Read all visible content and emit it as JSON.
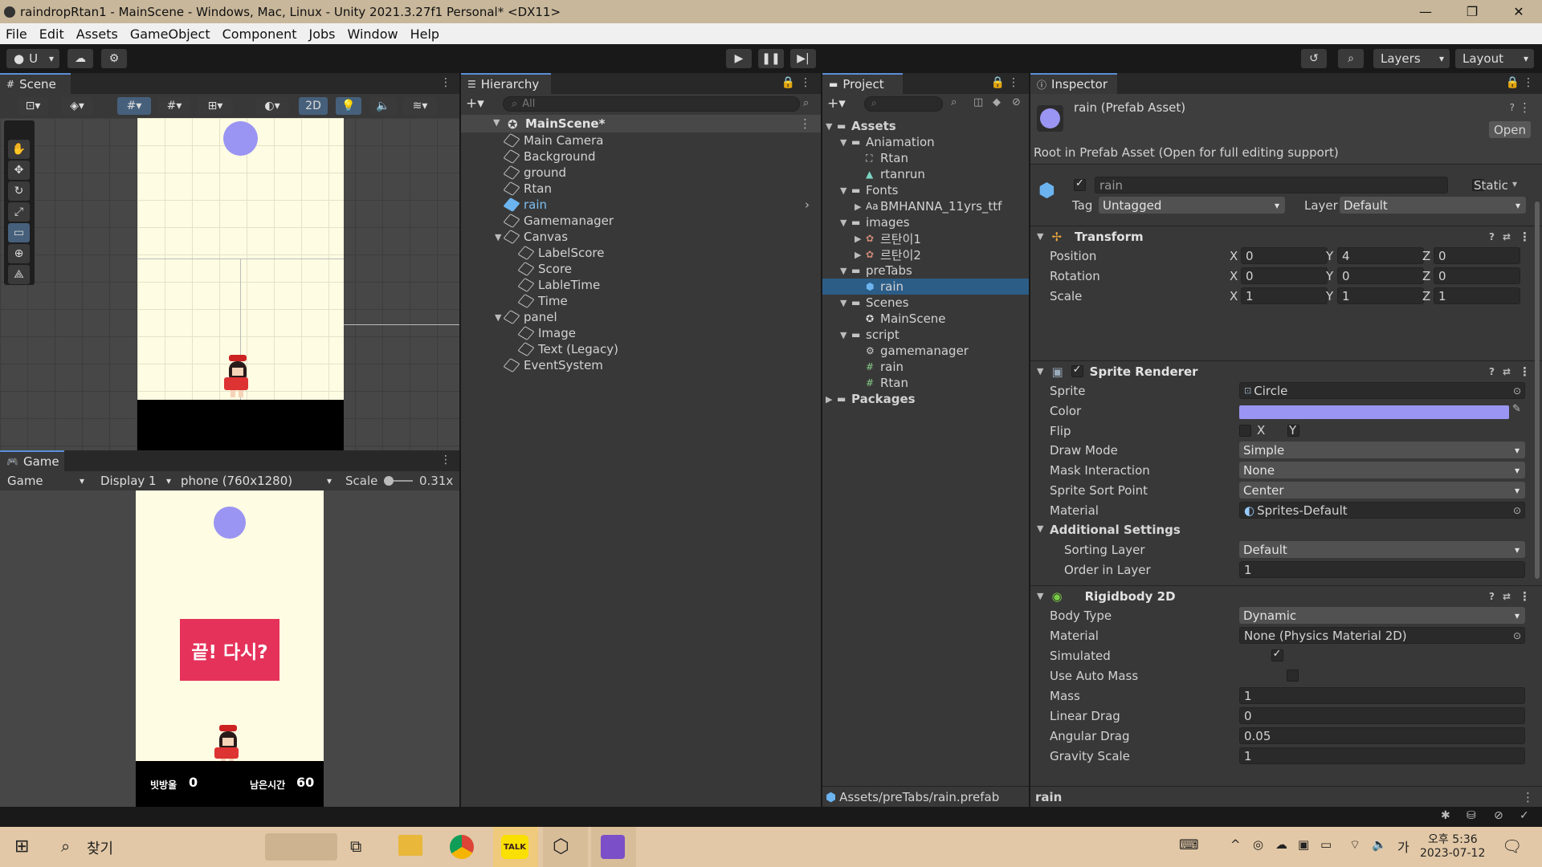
{
  "window": {
    "title": "raindropRtan1 - MainScene - Windows, Mac, Linux - Unity 2021.3.27f1 Personal* <DX11>",
    "minimize": "—",
    "restore": "❐",
    "close": "✕"
  },
  "menu": [
    "File",
    "Edit",
    "Assets",
    "GameObject",
    "Component",
    "Jobs",
    "Window",
    "Help"
  ],
  "toolbar": {
    "account": "U",
    "layers": "Layers",
    "layout": "Layout"
  },
  "scene": {
    "tab": "Scene",
    "mode_2d": "2D"
  },
  "game": {
    "tab": "Game",
    "mode": "Game",
    "display": "Display 1",
    "resolution": "phone (760x1280)",
    "scale_label": "Scale",
    "scale_value": "0.31x",
    "end_button": "끝! 다시?",
    "hud_score_label": "빗방울",
    "hud_score_value": "0",
    "hud_time_label": "남은시간",
    "hud_time_value": "60"
  },
  "hierarchy": {
    "tab": "Hierarchy",
    "search_placeholder": "All",
    "root": "MainScene*",
    "items": [
      {
        "label": "Main Camera",
        "depth": 1
      },
      {
        "label": "Background",
        "depth": 1
      },
      {
        "label": "ground",
        "depth": 1
      },
      {
        "label": "Rtan",
        "depth": 1
      },
      {
        "label": "rain",
        "depth": 1,
        "prefab": true
      },
      {
        "label": "Gamemanager",
        "depth": 1
      },
      {
        "label": "Canvas",
        "depth": 1,
        "expanded": true
      },
      {
        "label": "LabelScore",
        "depth": 2
      },
      {
        "label": "Score",
        "depth": 2
      },
      {
        "label": "LableTime",
        "depth": 2
      },
      {
        "label": "Time",
        "depth": 2
      },
      {
        "label": "panel",
        "depth": 1,
        "expanded": true
      },
      {
        "label": "Image",
        "depth": 2
      },
      {
        "label": "Text (Legacy)",
        "depth": 2
      },
      {
        "label": "EventSystem",
        "depth": 1
      }
    ]
  },
  "project": {
    "tab": "Project",
    "items": [
      {
        "label": "Assets",
        "depth": 0,
        "type": "folder",
        "expanded": true,
        "bold": true
      },
      {
        "label": "Aniamation",
        "depth": 1,
        "type": "folder",
        "expanded": true
      },
      {
        "label": "Rtan",
        "depth": 2,
        "type": "anim"
      },
      {
        "label": "rtanrun",
        "depth": 2,
        "type": "clip"
      },
      {
        "label": "Fonts",
        "depth": 1,
        "type": "folder",
        "expanded": true
      },
      {
        "label": "BMHANNA_11yrs_ttf",
        "depth": 2,
        "type": "font",
        "collapsed": true
      },
      {
        "label": "images",
        "depth": 1,
        "type": "folder",
        "expanded": true
      },
      {
        "label": "르탄이1",
        "depth": 2,
        "type": "sprite",
        "collapsed": true
      },
      {
        "label": "르탄이2",
        "depth": 2,
        "type": "sprite",
        "collapsed": true
      },
      {
        "label": "preTabs",
        "depth": 1,
        "type": "folder",
        "expanded": true
      },
      {
        "label": "rain",
        "depth": 2,
        "type": "prefab",
        "selected": true
      },
      {
        "label": "Scenes",
        "depth": 1,
        "type": "folder",
        "expanded": true
      },
      {
        "label": "MainScene",
        "depth": 2,
        "type": "scene"
      },
      {
        "label": "script",
        "depth": 1,
        "type": "folder",
        "expanded": true
      },
      {
        "label": "gamemanager",
        "depth": 2,
        "type": "gear"
      },
      {
        "label": "rain",
        "depth": 2,
        "type": "script"
      },
      {
        "label": "Rtan",
        "depth": 2,
        "type": "script"
      },
      {
        "label": "Packages",
        "depth": 0,
        "type": "folder",
        "collapsed": true,
        "bold": true
      }
    ],
    "path": "Assets/preTabs/rain.prefab"
  },
  "inspector": {
    "tab": "Inspector",
    "asset_title": "rain (Prefab Asset)",
    "open_button": "Open",
    "root_note": "Root in Prefab Asset (Open for full editing support)",
    "name": "rain",
    "static_label": "Static",
    "tag_label": "Tag",
    "tag_value": "Untagged",
    "layer_label": "Layer",
    "layer_value": "Default",
    "transform": {
      "title": "Transform",
      "position_label": "Position",
      "position": {
        "x": "0",
        "y": "4",
        "z": "0"
      },
      "rotation_label": "Rotation",
      "rotation": {
        "x": "0",
        "y": "0",
        "z": "0"
      },
      "scale_label": "Scale",
      "scale": {
        "x": "1",
        "y": "1",
        "z": "1"
      }
    },
    "sprite_renderer": {
      "title": "Sprite Renderer",
      "sprite_label": "Sprite",
      "sprite_value": "Circle",
      "color_label": "Color",
      "color_value": "#9a95f2",
      "flip_label": "Flip",
      "flip_x": "X",
      "flip_y": "Y",
      "draw_mode_label": "Draw Mode",
      "draw_mode": "Simple",
      "mask_label": "Mask Interaction",
      "mask": "None",
      "sort_point_label": "Sprite Sort Point",
      "sort_point": "Center",
      "material_label": "Material",
      "material": "Sprites-Default",
      "additional_label": "Additional Settings",
      "sorting_layer_label": "Sorting Layer",
      "sorting_layer": "Default",
      "order_label": "Order in Layer",
      "order": "1"
    },
    "rigidbody": {
      "title": "Rigidbody 2D",
      "body_type_label": "Body Type",
      "body_type": "Dynamic",
      "material_label": "Material",
      "material": "None (Physics Material 2D)",
      "simulated_label": "Simulated",
      "auto_mass_label": "Use Auto Mass",
      "mass_label": "Mass",
      "mass": "1",
      "linear_drag_label": "Linear Drag",
      "linear_drag": "0",
      "angular_drag_label": "Angular Drag",
      "angular_drag": "0.05",
      "gravity_label": "Gravity Scale",
      "gravity": "1"
    },
    "footer": "rain"
  },
  "taskbar": {
    "search": "찾기",
    "time": "오후 5:36",
    "date": "2023-07-12",
    "ime": "가"
  },
  "colors": {
    "rain": "#9a95f2",
    "selection": "#2c5d87",
    "end_button_bg": "#e5325a"
  }
}
